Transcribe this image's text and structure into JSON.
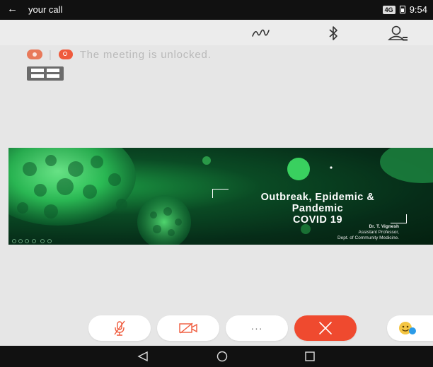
{
  "status_bar": {
    "back_glyph": "←",
    "title": "your call",
    "network": "4G",
    "time": "9:54"
  },
  "notice": {
    "separator": "|",
    "text": "The meeting is unlocked."
  },
  "slide": {
    "title_lines": [
      "Outbreak, Epidemic &",
      "Pandemic",
      "COVID 19"
    ],
    "author_lines": [
      "Dr. T. Vignesh",
      "Assistant Professor,",
      "Dept. of Community Medicine."
    ]
  },
  "controls": {
    "more_label": "···"
  },
  "colors": {
    "end_call": "#ef4a2f",
    "mute_stroke": "#ef5a3c",
    "lock_icon": "#ef5a3c"
  }
}
